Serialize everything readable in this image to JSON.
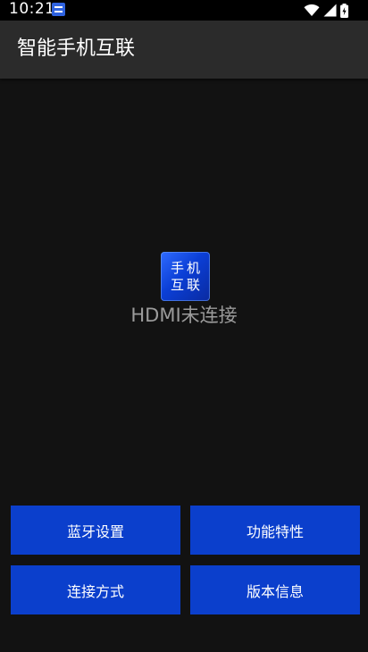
{
  "status_bar": {
    "time": "10:21",
    "icons": [
      "app-notification-icon",
      "wifi-icon",
      "cellular-signal-icon",
      "battery-icon"
    ]
  },
  "app_bar": {
    "title": "智能手机互联"
  },
  "main": {
    "logo_line1": "手机",
    "logo_line2": "互联",
    "hdmi_status": "HDMI未连接"
  },
  "buttons": {
    "bluetooth_settings": "蓝牙设置",
    "features": "功能特性",
    "connection_method": "连接方式",
    "version_info": "版本信息"
  },
  "colors": {
    "button_bg": "#0b3fcc",
    "app_bar_bg": "#2b2b2b",
    "screen_bg": "#121212",
    "status_text_gray": "#9b9b9b"
  }
}
